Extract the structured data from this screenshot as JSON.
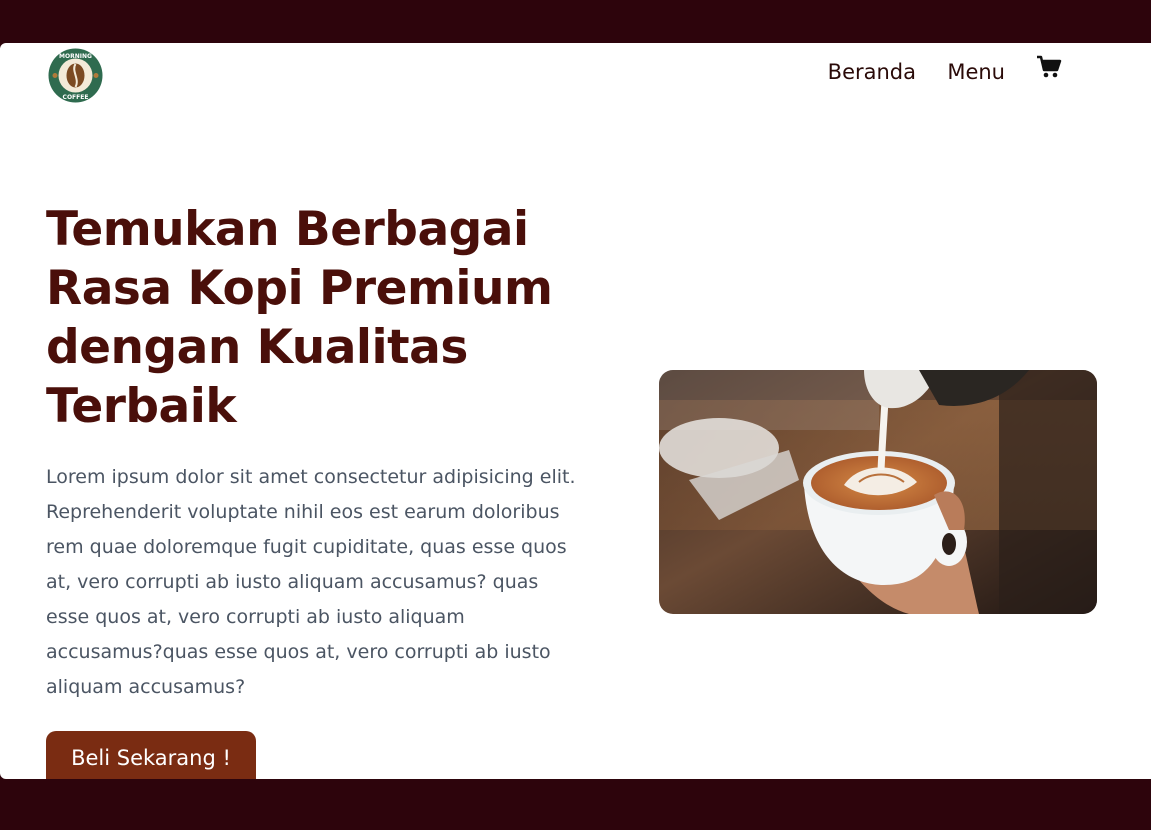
{
  "brand": {
    "logo_text_top": "MORNING",
    "logo_text_bottom": "COFFEE"
  },
  "nav": {
    "beranda": "Beranda",
    "menu": "Menu",
    "cart_icon": "cart-icon"
  },
  "hero": {
    "title": "Temukan Berbagai Rasa Kopi Premium dengan Kualitas Terbaik",
    "description": "Lorem ipsum dolor sit amet consectetur adipisicing elit. Reprehenderit voluptate nihil eos est earum doloribus rem quae doloremque fugit cupiditate, quas esse quos at, vero corrupti ab iusto aliquam accusamus? quas esse quos at, vero corrupti ab iusto aliquam accusamus?quas esse quos at, vero corrupti ab iusto aliquam accusamus?",
    "cta_label": "Beli Sekarang !"
  },
  "colors": {
    "frame": "#2d040c",
    "heading": "#4a0f0a",
    "button": "#7a2c12",
    "logo_green": "#2f6b4f"
  }
}
